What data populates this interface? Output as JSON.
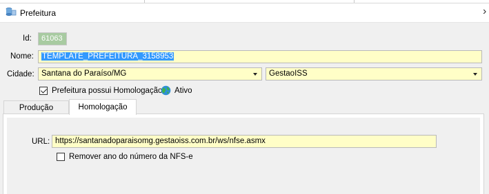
{
  "window": {
    "title": "Prefeitura",
    "icon": "database-icon"
  },
  "form": {
    "id_label": "Id:",
    "id_value": "61063",
    "nome_label": "Nome:",
    "nome_value": "TEMPLATE_PREFEITURA_3158953",
    "cidade_label": "Cidade:",
    "cidade_value": "Santana do Paraíso/MG",
    "provider_value": "GestaoISS",
    "homologacao_checkbox_label": "Prefeitura possui Homologação",
    "homologacao_checked": true,
    "status_label": "Ativo",
    "status_icon": "globe-icon"
  },
  "tabs": [
    {
      "label": "Produção",
      "active": false
    },
    {
      "label": "Homologação",
      "active": true
    }
  ],
  "homologacao": {
    "url_label": "URL:",
    "url_value": "https://santanadoparaisomg.gestaoiss.com.br/ws/nfse.asmx",
    "remover_ano_label": "Remover ano do número da NFS-e",
    "remover_ano_checked": false
  },
  "colors": {
    "field_bg": "#fffec7",
    "id_bg": "#a8cba1",
    "selection": "#3399ff"
  }
}
